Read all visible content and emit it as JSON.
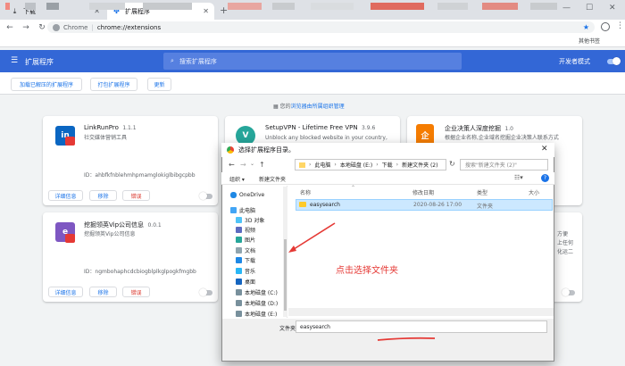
{
  "browser": {
    "tabs": [
      {
        "label": "下载",
        "icon": "download-icon"
      },
      {
        "label": "扩展程序",
        "icon": "puzzle-icon"
      }
    ],
    "url_prefix": "Chrome",
    "url": "chrome://extensions",
    "bookmark_other": "其他书签"
  },
  "extensions": {
    "title": "扩展程序",
    "search_placeholder": "搜索扩展程序",
    "dev_mode": "开发者模式",
    "buttons": [
      "加载已解压的扩展程序",
      "打包扩展程序",
      "更新"
    ],
    "managed_prefix": "您的",
    "managed_link": "浏览器由所属组织管理",
    "card_buttons": {
      "details": "详细信息",
      "remove": "移除",
      "errors": "错误"
    },
    "cards": [
      {
        "name": "LinkRunPro",
        "version": "1.1.1",
        "desc": "社交媒体营销工具",
        "id": "ID：ahbfkfnblehmhpmamglokiglbibgcpbb",
        "color": "#0a66c2",
        "icon": "linkedin-icon",
        "mark": "in"
      },
      {
        "name": "SetupVPN - Lifetime Free VPN",
        "version": "3.9.6",
        "desc": "Unblock any blocked website in your country,",
        "color": "#26a69a",
        "icon": "vpn-icon",
        "mark": "V"
      },
      {
        "name": "企业决策人深度挖掘",
        "version": "1.0",
        "desc": "根据企业名称,企业域名挖掘企业决策人联系方式",
        "color": "#f57c00",
        "icon": "building-icon",
        "mark": "企"
      },
      {
        "name": "挖掘领英Vip公司信息",
        "version": "0.0.1",
        "desc": "挖掘领英Vip公司信息",
        "id": "ID：ngmbohaphcdcbiogblplkglpogkfmgbb",
        "color": "#7e57c2",
        "icon": "extension-logo-icon",
        "mark": "e"
      }
    ],
    "cut_text": [
      "方便",
      "上任何",
      "化运二"
    ]
  },
  "dialog": {
    "title": "选择扩展程序目录。",
    "breadcrumb": [
      "此电脑",
      "本地磁盘 (E:)",
      "下载",
      "新建文件夹 (2)"
    ],
    "search_placeholder": "搜索\"新建文件夹 (2)\"",
    "organize": "组织 ▾",
    "new_folder": "新建文件夹",
    "nav": [
      "OneDrive",
      "此电脑",
      "3D 对象",
      "视频",
      "图片",
      "文档",
      "下载",
      "音乐",
      "桌面",
      "本地磁盘 (C:)",
      "本地磁盘 (D:)",
      "本地磁盘 (E:)"
    ],
    "columns": [
      "名称",
      "修改日期",
      "类型",
      "大小"
    ],
    "files": [
      {
        "name": "easysearch",
        "date": "2020-08-26 17:00",
        "type": "文件夹"
      }
    ],
    "folder_label": "文件夹:",
    "folder_value": "easysearch"
  },
  "annotation": "点击选择文件夹",
  "colors": {
    "accent": "#3367d6",
    "annotation": "#e53935",
    "selection": "#cce8ff"
  }
}
